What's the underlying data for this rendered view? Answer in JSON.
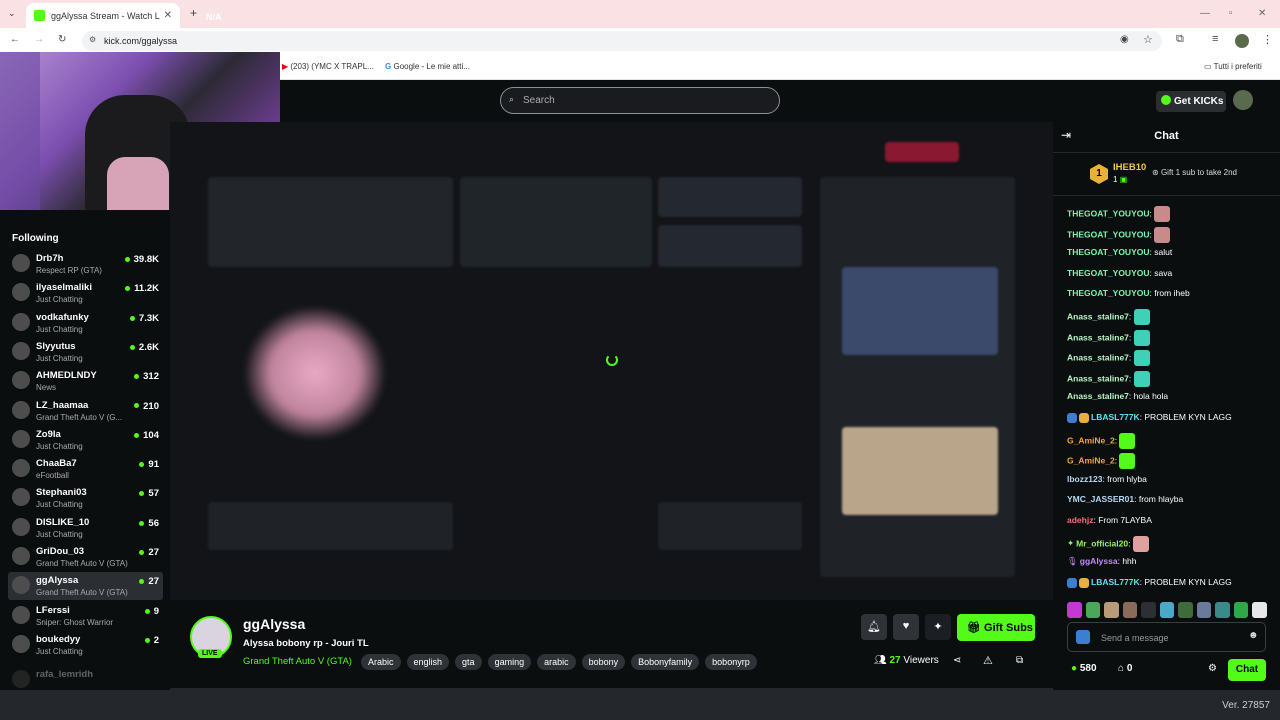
{
  "browser": {
    "tab_title": "ggAlyssa Stream - Watch Live o",
    "tab_badge": "N/A",
    "url": "kick.com/ggalyssa",
    "bookmarks": [
      "(203) (YMC X TRAPL...",
      "Google - Le mie atti..."
    ],
    "bookmarks_folder": "Tutti i preferiti"
  },
  "header": {
    "search_placeholder": "Search",
    "get_kicks": "Get KICKs"
  },
  "sidebar": {
    "heading": "Following",
    "items": [
      {
        "name": "Drb7h",
        "category": "Respect RP (GTA)",
        "viewers": "39.8K"
      },
      {
        "name": "ilyaselmaliki",
        "category": "Just Chatting",
        "viewers": "11.2K"
      },
      {
        "name": "vodkafunky",
        "category": "Just Chatting",
        "viewers": "7.3K"
      },
      {
        "name": "Slyyutus",
        "category": "Just Chatting",
        "viewers": "2.6K"
      },
      {
        "name": "AHMEDLNDY",
        "category": "News",
        "viewers": "312"
      },
      {
        "name": "LZ_haamaa",
        "category": "Grand Theft Auto V (G...",
        "viewers": "210"
      },
      {
        "name": "Zo9la",
        "category": "Just Chatting",
        "viewers": "104"
      },
      {
        "name": "ChaaBa7",
        "category": "eFootball",
        "viewers": "91"
      },
      {
        "name": "Stephani03",
        "category": "Just Chatting",
        "viewers": "57"
      },
      {
        "name": "DISLIKE_10",
        "category": "Just Chatting",
        "viewers": "56"
      },
      {
        "name": "GriDou_03",
        "category": "Grand Theft Auto V (GTA)",
        "viewers": "27"
      },
      {
        "name": "ggAlyssa",
        "category": "Grand Theft Auto V (GTA)",
        "viewers": "27"
      },
      {
        "name": "LFerssi",
        "category": "Sniper: Ghost Warrior",
        "viewers": "9"
      },
      {
        "name": "boukedyy",
        "category": "Just Chatting",
        "viewers": "2"
      }
    ],
    "faded_item": "rafa_lemridh"
  },
  "stream": {
    "streamer": "ggAlyssa",
    "live_label": "LIVE",
    "title": "Alyssa bobony rp - Jouri TL",
    "category": "Grand Theft Auto V (GTA)",
    "tags": [
      "Arabic",
      "english",
      "gta",
      "gaming",
      "arabic",
      "bobony",
      "Bobonyfamily",
      "bobonyrp"
    ],
    "viewers_count": "27",
    "viewers_label": "Viewers",
    "gift_subs": "Gift Subs"
  },
  "chat": {
    "heading": "Chat",
    "pinned_user": "IHEB10",
    "pinned_rank": "1",
    "pinned_level": "1",
    "pinned_text": "Gift 1 sub to take 2nd",
    "messages": [
      {
        "user": "THEGOAT_YOUYOU",
        "text": "",
        "color": "#7cf6b0"
      },
      {
        "user": "THEGOAT_YOUYOU",
        "text": "",
        "color": "#7cf6b0"
      },
      {
        "user": "THEGOAT_YOUYOU",
        "text": "salut",
        "color": "#7cf6b0"
      },
      {
        "user": "THEGOAT_YOUYOU",
        "text": "sava",
        "color": "#7cf6b0"
      },
      {
        "user": "THEGOAT_YOUYOU",
        "text": "from iheb",
        "color": "#7cf6b0"
      },
      {
        "user": "Anass_staline7",
        "text": "",
        "color": "#b9f7c6"
      },
      {
        "user": "Anass_staline7",
        "text": "",
        "color": "#b9f7c6"
      },
      {
        "user": "Anass_staline7",
        "text": "",
        "color": "#b9f7c6"
      },
      {
        "user": "Anass_staline7",
        "text": "",
        "color": "#b9f7c6"
      },
      {
        "user": "Anass_staline7",
        "text": "hola hola",
        "color": "#b9f7c6"
      },
      {
        "user": "LBASL777K",
        "text": "PROBLEM KYN LAGG",
        "color": "#5ee1f5"
      },
      {
        "user": "G_AmiNe_2",
        "text": "",
        "color": "#f5a340"
      },
      {
        "user": "G_AmiNe_2",
        "text": "",
        "color": "#f5a340"
      },
      {
        "user": "lbozz123",
        "text": "from hlyba",
        "color": "#b6d8f5"
      },
      {
        "user": "YMC_JASSER01",
        "text": "from hlayba",
        "color": "#b6d8f5"
      },
      {
        "user": "adehjz",
        "text": "From 7LAYBA",
        "color": "#f56f7a"
      },
      {
        "user": "Mr_official20",
        "text": "",
        "color": "#9bf26a"
      },
      {
        "user": "ggAlyssa",
        "text": "hhh",
        "color": "#c28df5"
      },
      {
        "user": "LBASL777K",
        "text": "PROBLEM KYN LAGG",
        "color": "#5ee1f5"
      }
    ],
    "send_placeholder": "Send a message",
    "kicks_balance": "580",
    "second_count": "0",
    "chat_button": "Chat"
  },
  "footer": {
    "version": "Ver. 27857"
  }
}
